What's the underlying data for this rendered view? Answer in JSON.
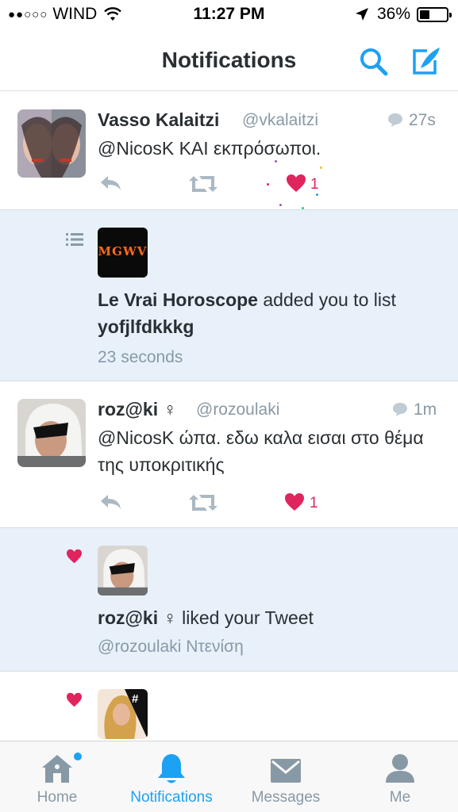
{
  "status_bar": {
    "carrier": "WIND",
    "time": "11:27 PM",
    "battery": "36%"
  },
  "nav": {
    "title": "Notifications"
  },
  "feed": {
    "tweet1": {
      "name": "Vasso Kalaitzi",
      "handle": "@vkalaitzi",
      "time": "27s",
      "text": "@NicosK ΚΑΙ εκπρόσωποι.",
      "likes": "1"
    },
    "notif1": {
      "avatar_text": "MGWV",
      "actor": "Le Vrai Horoscope",
      "action": " added you to list ",
      "list_name": "yofjlfdkkkg",
      "time": "23 seconds"
    },
    "tweet2": {
      "name": "roz@ki ♀",
      "handle": "@rozoulaki",
      "time": "1m",
      "text": "@NicosK ώπα. εδω καλα εισαι στο θέμα της υποκριτικής",
      "likes": "1"
    },
    "notif2": {
      "actor": "roz@ki ♀",
      "action": " liked your Tweet",
      "sub": "@rozoulaki Ντενίση"
    },
    "notif3": {
      "avatar_badge": "#"
    }
  },
  "tabs": [
    {
      "label": "Home",
      "icon": "home-icon"
    },
    {
      "label": "Notifications",
      "icon": "bell-icon"
    },
    {
      "label": "Messages",
      "icon": "envelope-icon"
    },
    {
      "label": "Me",
      "icon": "person-icon"
    }
  ],
  "colors": {
    "accent": "#1da1f2",
    "like": "#e0245e",
    "muted": "#8899a6",
    "highlight_bg": "#e8f1fa"
  }
}
